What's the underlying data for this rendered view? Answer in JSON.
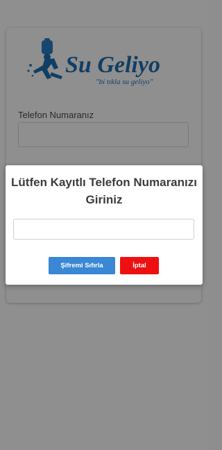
{
  "login": {
    "logo_text": "Su Geliyo",
    "logo_slogan": "\"bi tıkla su geliyo\"",
    "phone_label": "Telefon Numaranız",
    "phone_value": ""
  },
  "modal": {
    "title": "Lütfen Kayıtlı Telefon Numaranızı Giriniz",
    "input_value": "",
    "reset_button": "Şifremi Sıfırla",
    "cancel_button": "İptal"
  },
  "colors": {
    "brand_blue": "#1f6fb2",
    "reset_button": "#3a87d4",
    "cancel_button": "#ee1010"
  }
}
